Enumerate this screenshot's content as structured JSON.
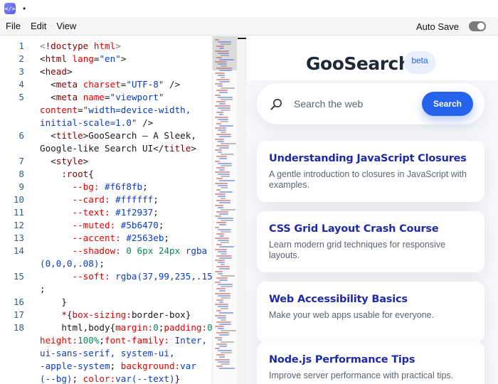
{
  "window": {
    "app_icon_glyph": "</>",
    "title": "•"
  },
  "menubar": {
    "items": [
      "File",
      "Edit",
      "View"
    ],
    "autosave_label": "Auto Save",
    "autosave_on": true
  },
  "editor": {
    "line_numbers": [
      {
        "n": "1",
        "row": 0
      },
      {
        "n": "2",
        "row": 1
      },
      {
        "n": "3",
        "row": 2
      },
      {
        "n": "4",
        "row": 3
      },
      {
        "n": "5",
        "row": 4
      },
      {
        "n": "6",
        "row": 7
      },
      {
        "n": "7",
        "row": 9
      },
      {
        "n": "8",
        "row": 10
      },
      {
        "n": "9",
        "row": 11
      },
      {
        "n": "10",
        "row": 12
      },
      {
        "n": "11",
        "row": 13
      },
      {
        "n": "12",
        "row": 14
      },
      {
        "n": "13",
        "row": 15
      },
      {
        "n": "14",
        "row": 16
      },
      {
        "n": "15",
        "row": 18
      },
      {
        "n": "16",
        "row": 20
      },
      {
        "n": "17",
        "row": 21
      },
      {
        "n": "18",
        "row": 22
      }
    ],
    "lines": [
      [
        [
          "t-gray",
          "<"
        ],
        [
          "t-tag",
          "!doctype"
        ],
        [
          "t-text",
          " "
        ],
        [
          "t-attr",
          "html"
        ],
        [
          "t-gray",
          ">"
        ]
      ],
      [
        [
          "t-text",
          "<"
        ],
        [
          "t-tag",
          "html"
        ],
        [
          "t-text",
          " "
        ],
        [
          "t-attr",
          "lang"
        ],
        [
          "t-text",
          "="
        ],
        [
          "t-str",
          "\"en\""
        ],
        [
          "t-text",
          ">"
        ]
      ],
      [
        [
          "t-text",
          "<"
        ],
        [
          "t-tag",
          "head"
        ],
        [
          "t-text",
          ">"
        ]
      ],
      [
        [
          "t-text",
          "  <"
        ],
        [
          "t-tag",
          "meta"
        ],
        [
          "t-text",
          " "
        ],
        [
          "t-attr",
          "charset"
        ],
        [
          "t-text",
          "="
        ],
        [
          "t-str",
          "\"UTF-8\""
        ],
        [
          "t-text",
          " />"
        ]
      ],
      [
        [
          "t-text",
          "  <"
        ],
        [
          "t-tag",
          "meta"
        ],
        [
          "t-text",
          " "
        ],
        [
          "t-attr",
          "name"
        ],
        [
          "t-text",
          "="
        ],
        [
          "t-str",
          "\"viewport\""
        ]
      ],
      [
        [
          "t-attr",
          "content"
        ],
        [
          "t-text",
          "="
        ],
        [
          "t-str",
          "\"width=device-width,"
        ]
      ],
      [
        [
          "t-str",
          "initial-scale=1.0\""
        ],
        [
          "t-text",
          " />"
        ]
      ],
      [
        [
          "t-text",
          "  <"
        ],
        [
          "t-tag",
          "title"
        ],
        [
          "t-text",
          ">GooSearch — A Sleek,"
        ]
      ],
      [
        [
          "t-text",
          "Google-like Search UI</"
        ],
        [
          "t-tag",
          "title"
        ],
        [
          "t-text",
          ">"
        ]
      ],
      [
        [
          "t-text",
          "  <"
        ],
        [
          "t-tag",
          "style"
        ],
        [
          "t-text",
          ">"
        ]
      ],
      [
        [
          "t-text",
          "    "
        ],
        [
          "t-sel",
          ":root"
        ],
        [
          "t-text",
          "{"
        ]
      ],
      [
        [
          "t-text",
          "      "
        ],
        [
          "t-prop",
          "--bg:"
        ],
        [
          "t-text",
          " "
        ],
        [
          "t-str",
          "#f6f8fb"
        ],
        [
          "t-text",
          ";"
        ]
      ],
      [
        [
          "t-text",
          "      "
        ],
        [
          "t-prop",
          "--card:"
        ],
        [
          "t-text",
          " "
        ],
        [
          "t-str",
          "#ffffff"
        ],
        [
          "t-text",
          ";"
        ]
      ],
      [
        [
          "t-text",
          "      "
        ],
        [
          "t-prop",
          "--text:"
        ],
        [
          "t-text",
          " "
        ],
        [
          "t-str",
          "#1f2937"
        ],
        [
          "t-text",
          ";"
        ]
      ],
      [
        [
          "t-text",
          "      "
        ],
        [
          "t-prop",
          "--muted:"
        ],
        [
          "t-text",
          " "
        ],
        [
          "t-str",
          "#5b6470"
        ],
        [
          "t-text",
          ";"
        ]
      ],
      [
        [
          "t-text",
          "      "
        ],
        [
          "t-prop",
          "--accent:"
        ],
        [
          "t-text",
          " "
        ],
        [
          "t-str",
          "#2563eb"
        ],
        [
          "t-text",
          ";"
        ]
      ],
      [
        [
          "t-text",
          "      "
        ],
        [
          "t-prop",
          "--shadow:"
        ],
        [
          "t-text",
          " "
        ],
        [
          "t-num",
          "0"
        ],
        [
          "t-text",
          " "
        ],
        [
          "t-num",
          "6px"
        ],
        [
          "t-text",
          " "
        ],
        [
          "t-num",
          "24px"
        ],
        [
          "t-text",
          " "
        ],
        [
          "t-str",
          "rgba"
        ]
      ],
      [
        [
          "t-str",
          "(0,0,0,.08)"
        ],
        [
          "t-text",
          ";"
        ]
      ],
      [
        [
          "t-text",
          "      "
        ],
        [
          "t-prop",
          "--soft:"
        ],
        [
          "t-text",
          " "
        ],
        [
          "t-str",
          "rgba(37,99,235,.15)"
        ]
      ],
      [
        [
          "t-text",
          ";"
        ]
      ],
      [
        [
          "t-text",
          "    }"
        ]
      ],
      [
        [
          "t-text",
          "    "
        ],
        [
          "t-sel",
          "*"
        ],
        [
          "t-text",
          "{"
        ],
        [
          "t-prop",
          "box-sizing:"
        ],
        [
          "t-text",
          "border-box}"
        ]
      ],
      [
        [
          "t-text",
          "    html,body{"
        ],
        [
          "t-prop",
          "margin:"
        ],
        [
          "t-num",
          "0"
        ],
        [
          "t-text",
          ";"
        ],
        [
          "t-prop",
          "padding:"
        ],
        [
          "t-num",
          "0"
        ],
        [
          "t-text",
          ";"
        ]
      ],
      [
        [
          "t-prop",
          "height:"
        ],
        [
          "t-num",
          "100%"
        ],
        [
          "t-text",
          ";"
        ],
        [
          "t-prop",
          "font-family:"
        ],
        [
          "t-text",
          " "
        ],
        [
          "t-str",
          "Inter,"
        ]
      ],
      [
        [
          "t-str",
          "ui-sans-serif, system-ui,"
        ]
      ],
      [
        [
          "t-str",
          "-apple-system"
        ],
        [
          "t-text",
          "; "
        ],
        [
          "t-prop",
          "background:"
        ],
        [
          "t-str",
          "var"
        ]
      ],
      [
        [
          "t-str",
          "(--bg)"
        ],
        [
          "t-text",
          "; "
        ],
        [
          "t-prop",
          "color:"
        ],
        [
          "t-str",
          "var(--text)"
        ],
        [
          "t-text",
          "}"
        ]
      ]
    ]
  },
  "preview": {
    "brand": "GooSearch",
    "badge": "beta",
    "search": {
      "placeholder": "Search the web",
      "button_label": "Search"
    },
    "results": [
      {
        "title": "Understanding JavaScript Closures",
        "desc": "A gentle introduction to closures in JavaScript with examples."
      },
      {
        "title": "CSS Grid Layout Crash Course",
        "desc": "Learn modern grid techniques for responsive layouts."
      },
      {
        "title": "Web Accessibility Basics",
        "desc": "Make your web apps usable for everyone."
      },
      {
        "title": "Node.js Performance Tips",
        "desc": "Improve server performance with practical tips."
      }
    ]
  },
  "colors": {
    "accent": "#2563eb",
    "bg": "#f6f8fb",
    "text": "#1f2937",
    "muted": "#5b6470",
    "result_title": "#1e2aa8"
  }
}
